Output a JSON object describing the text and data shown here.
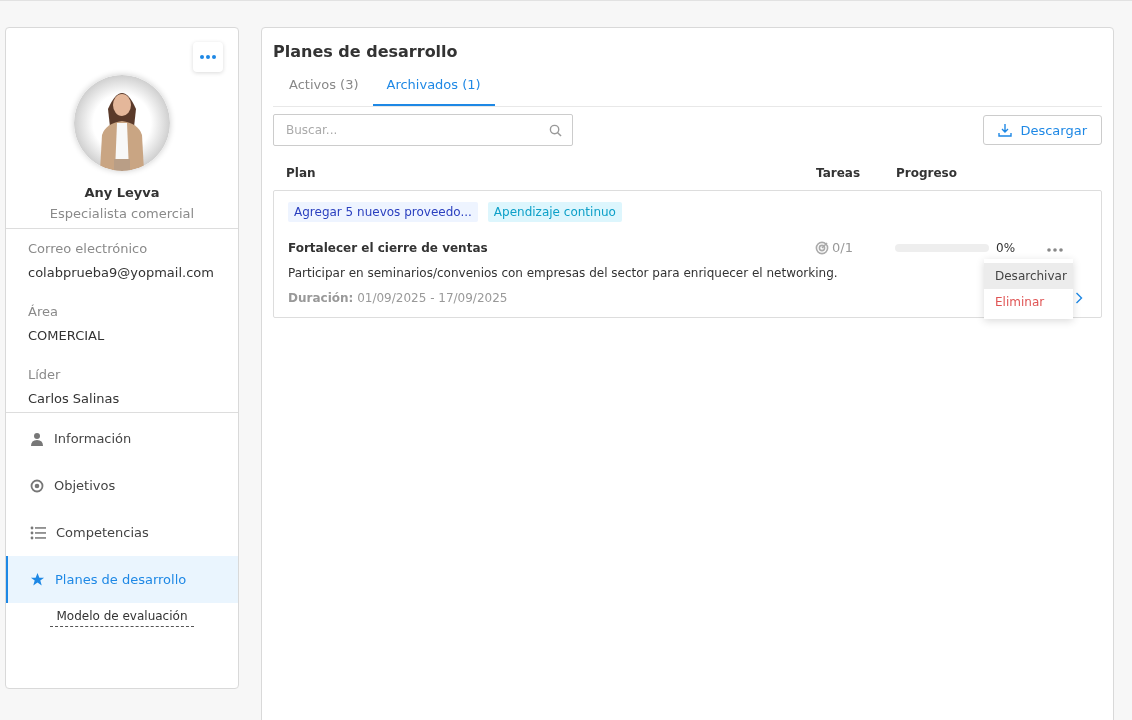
{
  "profile": {
    "name": "Any Leyva",
    "role": "Especialista comercial",
    "fields": [
      {
        "label": "Correo electrónico",
        "value": "colabprueba9@yopmail.com"
      },
      {
        "label": "Área",
        "value": "COMERCIAL"
      },
      {
        "label": "Líder",
        "value": "Carlos Salinas"
      }
    ]
  },
  "sidebar": {
    "items": [
      {
        "label": "Información",
        "kind": "person",
        "selected": false
      },
      {
        "label": "Objetivos",
        "kind": "target",
        "selected": false
      },
      {
        "label": "Competencias",
        "kind": "list",
        "selected": false
      },
      {
        "label": "Planes de desarrollo",
        "kind": "star",
        "selected": true
      }
    ],
    "footer_link": "Modelo de evaluación"
  },
  "main": {
    "title": "Planes de desarrollo",
    "tabs": [
      {
        "label": "Activos (3)",
        "selected": false
      },
      {
        "label": "Archivados (1)",
        "selected": true
      }
    ],
    "search": {
      "placeholder": "Buscar..."
    },
    "download_button": "Descargar",
    "columns": [
      "Plan",
      "Tareas",
      "Progreso"
    ],
    "plans": [
      {
        "tags": [
          {
            "label": "Agregar 5 nuevos proveedo...",
            "kind": "objective"
          },
          {
            "label": "Apendizaje continuo",
            "kind": "competency"
          }
        ],
        "title": "Fortalecer el cierre de ventas",
        "description": "Participar en seminarios/convenios con empresas del sector para enriquecer el networking.",
        "duration_label": "Duración:",
        "duration": "01/09/2025 - 17/09/2025",
        "tasks": "0/1",
        "level": 0,
        "progress": "0%",
        "menu": [
          {
            "label": "Desarchivar",
            "kind": "normal",
            "selected": true
          },
          {
            "label": "Eliminar",
            "kind": "danger",
            "selected": false
          }
        ]
      }
    ]
  }
}
